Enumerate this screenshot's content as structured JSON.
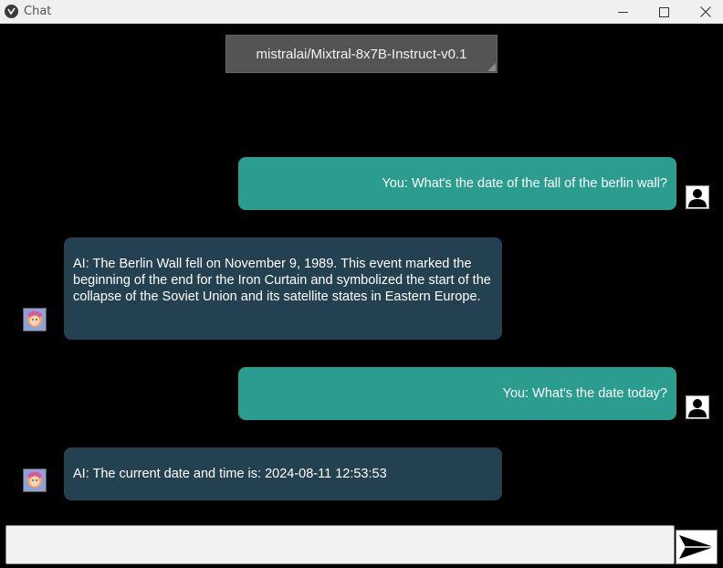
{
  "window": {
    "title": "Chat"
  },
  "model_selector": {
    "value": "mistralai/Mixtral-8x7B-Instruct-v0.1"
  },
  "messages": [
    {
      "role": "user",
      "text": "You: What's the date of the fall of the berlin wall?"
    },
    {
      "role": "ai",
      "text": "AI:  The Berlin Wall fell on November 9, 1989. This event marked the beginning of the end for the Iron Curtain and symbolized the start of the collapse of the Soviet Union and its satellite states in Eastern Europe."
    },
    {
      "role": "user",
      "text": "You: What's the date today?"
    },
    {
      "role": "ai",
      "text": "AI: The current date and time is: 2024-08-11 12:53:53"
    }
  ],
  "input": {
    "value": "",
    "placeholder": ""
  },
  "icons": {
    "app": "chat-app-icon",
    "minimize": "minimize-icon",
    "maximize": "maximize-icon",
    "close": "close-icon",
    "user_avatar": "user-silhouette-icon",
    "ai_avatar": "ai-portrait-icon",
    "send": "send-arrow-icon"
  },
  "colors": {
    "background": "#000000",
    "user_bubble": "#2a9d8f",
    "ai_bubble": "#234150",
    "model_selector": "#545454"
  }
}
